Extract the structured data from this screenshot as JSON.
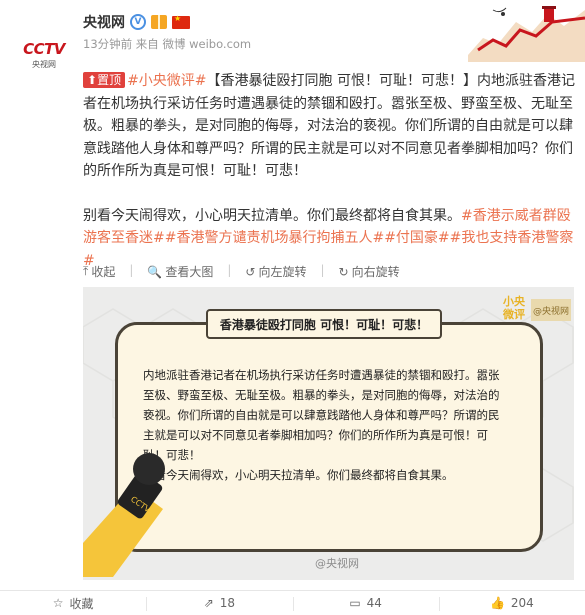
{
  "account": {
    "avatar_text": "CCTV",
    "avatar_sub": "央视网",
    "name": "央视网",
    "verified_label": "V",
    "time": "13分钟前",
    "source": "来自 微博 weibo.com"
  },
  "post": {
    "top_label": "置顶",
    "tag_main": "#小央微评#",
    "headline": "【香港暴徒殴打同胞 可恨！可耻！可悲！】",
    "body": "内地派驻香港记者在机场执行采访任务时遭遇暴徒的禁锢和殴打。嚣张至极、野蛮至极、无耻至极。粗暴的拳头，是对同胞的侮辱，对法治的亵视。你们所谓的自由就是可以肆意践踏他人身体和尊严吗？所谓的民主就是可以对不同意见者拳脚相加吗？你们的所作所为真是可恨！可耻！可悲！",
    "para2": "别看今天闹得欢，小心明天拉清单。你们最终都将自食其果。",
    "tags": [
      "#香港示威者群殴游客至香迷#",
      "#香港警方谴责机场暴行拘捕五人#",
      "#付国豪#",
      "#我也支持香港警察#"
    ]
  },
  "image_actions": {
    "collapse": "收起",
    "enlarge": "查看大图",
    "rotate_left": "向左旋转",
    "rotate_right": "向右旋转"
  },
  "image": {
    "title": "香港暴徒殴打同胞 可恨！可耻！可悲！",
    "brand_line1": "小央",
    "brand_line2": "微评",
    "brand_tag": "@央视网",
    "body_lines": [
      "内地派驻香港记者在机场执行采访任务时遭遇暴徒的禁锢和殴打。嚣张至极、野蛮至极、无耻至极。粗暴的拳头，是对同胞的侮辱，对法治的亵视。你们所谓的自由就是可以肆意践踏他人身体和尊严吗？所谓的民主就是可以对不同意见者拳脚相加吗？你们的所作所为真是可恨！可耻！可悲！",
      "别看今天闹得欢，小心明天拉清单。你们最终都将自食其果。"
    ],
    "watermark": "@央视网"
  },
  "footer": {
    "favorite_label": "收藏",
    "repost_count": "18",
    "comment_count": "44",
    "like_count": "204"
  },
  "colors": {
    "link": "#eb7350",
    "top_badge": "#e0413c",
    "verified": "#4a90e2"
  }
}
